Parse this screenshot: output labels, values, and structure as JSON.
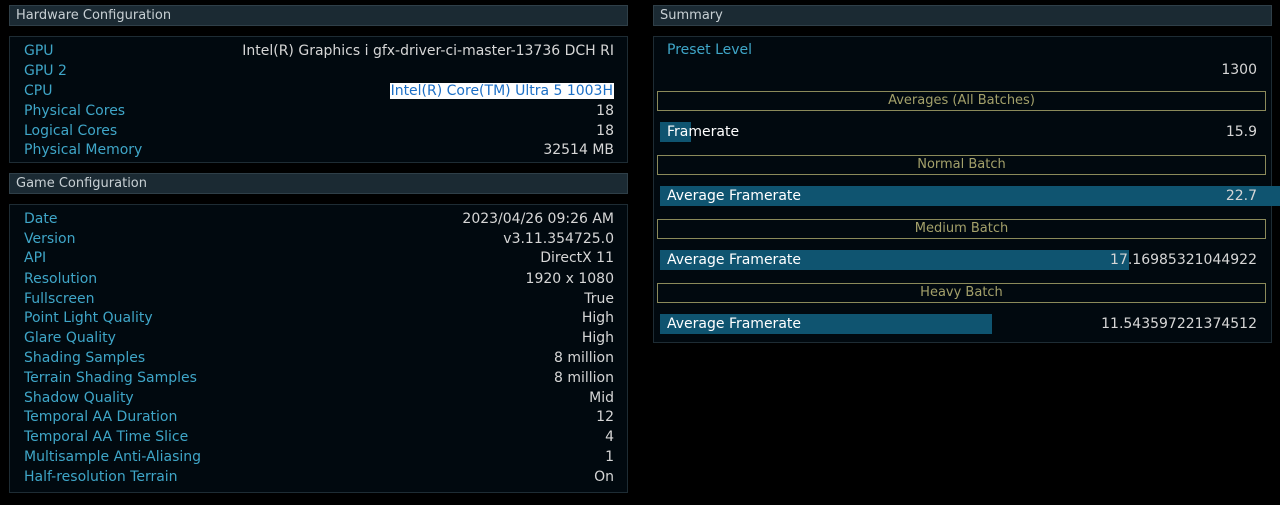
{
  "hardware": {
    "title": "Hardware Configuration",
    "rows": [
      {
        "label": "GPU",
        "value": "Intel(R) Graphics i gfx-driver-ci-master-13736 DCH RI"
      },
      {
        "label": "GPU 2",
        "value": ""
      },
      {
        "label": "CPU",
        "value": "Intel(R) Core(TM) Ultra 5 1003H"
      },
      {
        "label": "Physical Cores",
        "value": "18"
      },
      {
        "label": "Logical Cores",
        "value": "18"
      },
      {
        "label": "Physical Memory",
        "value": "32514 MB"
      }
    ]
  },
  "game": {
    "title": "Game Configuration",
    "rows": [
      {
        "label": "Date",
        "value": "2023/04/26 09:26 AM"
      },
      {
        "label": "Version",
        "value": "v3.11.354725.0"
      },
      {
        "label": "API",
        "value": "DirectX 11"
      },
      {
        "label": "Resolution",
        "value": "1920 x 1080"
      },
      {
        "label": "Fullscreen",
        "value": "True"
      },
      {
        "label": "Point Light Quality",
        "value": "High"
      },
      {
        "label": "Glare Quality",
        "value": "High"
      },
      {
        "label": "Shading Samples",
        "value": "8 million"
      },
      {
        "label": "Terrain Shading Samples",
        "value": "8 million"
      },
      {
        "label": "Shadow Quality",
        "value": "Mid"
      },
      {
        "label": "Temporal AA Duration",
        "value": "12"
      },
      {
        "label": "Temporal AA Time Slice",
        "value": "4"
      },
      {
        "label": "Multisample Anti-Aliasing",
        "value": "1"
      },
      {
        "label": "Half-resolution Terrain",
        "value": "On"
      }
    ]
  },
  "summary": {
    "title": "Summary",
    "preset_label": "Preset Level",
    "preset_value": "1300",
    "sections": [
      {
        "title": "Averages (All Batches)",
        "metric_label": "Framerate",
        "metric_value": "15.9",
        "fill_fraction": 0.05
      },
      {
        "title": "Normal Batch",
        "metric_label": "Average Framerate",
        "metric_value": "22.7",
        "fill_fraction": 1.0
      },
      {
        "title": "Medium Batch",
        "metric_label": "Average Framerate",
        "metric_value": "17.16985321044922",
        "fill_fraction": 0.756
      },
      {
        "title": "Heavy Batch",
        "metric_label": "Average Framerate",
        "metric_value": "11.543597221374512",
        "fill_fraction": 0.535
      }
    ]
  },
  "colors": {
    "label": "#3fa6c8",
    "value": "#d6d6d6",
    "bar_fill": "#0f5470",
    "section_border": "#8b8a5a",
    "header_bg": "#1b2a33"
  }
}
